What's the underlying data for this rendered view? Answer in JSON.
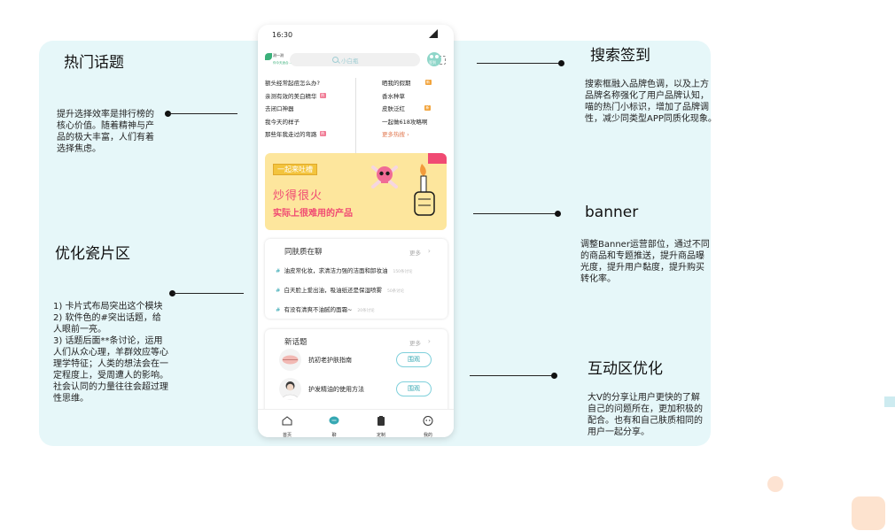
{
  "annotations": {
    "hot_topics": {
      "title": "热门话题",
      "body": "提升选择效率是排行榜的\n核心价值。随着精神与产\n品的极大丰富，人们有着\n选择焦虑。"
    },
    "card_zone": {
      "title": "优化瓷片区",
      "body": "1) 卡片式布局突出这个模块\n2) 软件色的#突出话题，给\n人眼前一亮。\n3) 话题后面**条讨论，运用\n人们从众心理，羊群效应等心\n理学特征；人类的想法会在一\n定程度上，受周遭人的影响。\n社会认同的力量往往会超过理\n性思维。"
    },
    "search_checkin": {
      "title": "搜索签到",
      "body": "搜索框融入品牌色调，以及上方\n品牌名称强化了用户品牌认知，\n喵的热门小标识，增加了品牌调\n性，减少同类型APP同质化现象。"
    },
    "banner": {
      "title": "banner",
      "body": "调整Banner运营部位，通过不同\n的商品和专题推送，提升商品曝\n光度，提升用户黏度，提升购买\n转化率。"
    },
    "interaction": {
      "title": "互动区优化",
      "body": "大V的分享让用户更快的了解\n自己的问题所在，更加积极的\n配合。也有和自己肤质相同的\n用户一起分享。"
    }
  },
  "phone": {
    "status_time": "16:30",
    "brand": {
      "line1": "测一测",
      "line2": "你今天适合..."
    },
    "search": {
      "placeholder": "小白瓶"
    },
    "checkin_label": "签到",
    "hot_topics_left": [
      {
        "text": "额头经常起痘怎么办?",
        "tag": null
      },
      {
        "text": "亲测有效的美白精华",
        "tag": "pink"
      },
      {
        "text": "去闭口神器",
        "tag": null
      },
      {
        "text": "我今天的样子",
        "tag": null
      },
      {
        "text": "那些年我走过的弯路",
        "tag": "pink"
      }
    ],
    "hot_topics_right": [
      {
        "text": "晒我的假期",
        "tag": "orange"
      },
      {
        "text": "香水种草",
        "tag": null
      },
      {
        "text": "皮肤泛红",
        "tag": "orange"
      },
      {
        "text": "一起做618攻略啊",
        "tag": null
      }
    ],
    "more_hot": "更多热搜 ›",
    "banner": {
      "label": "一起来吐槽",
      "title": "炒得很火",
      "subtitle": "实际上很难用的产品"
    },
    "same_skin": {
      "title": "同肤质在聊",
      "more": "更多",
      "items": [
        {
          "text": "油皮常化妆，求清洁力强的洁面和卸妆油",
          "count": "150条讨论"
        },
        {
          "text": "白天脸上爱出油，吸油纸还是保湿喷雾",
          "count": "50条讨论"
        },
        {
          "text": "有没有清爽不油腻的面霜~",
          "count": "20条讨论"
        }
      ]
    },
    "new_topics": {
      "title": "新话题",
      "more": "更多",
      "items": [
        {
          "title": "抗初老护肤指南",
          "button": "围观"
        },
        {
          "title": "护发精油的使用方法",
          "button": "围观"
        }
      ]
    },
    "tabs": [
      "首页",
      "聊",
      "定制",
      "我的"
    ]
  },
  "colors": {
    "brand": "#36a8b3",
    "canvas": "#e6f7f9",
    "banner_bg": "#fde69d",
    "banner_accent": "#f04a73",
    "tag_pink": "#f07a94",
    "tag_orange": "#f2a43c"
  }
}
